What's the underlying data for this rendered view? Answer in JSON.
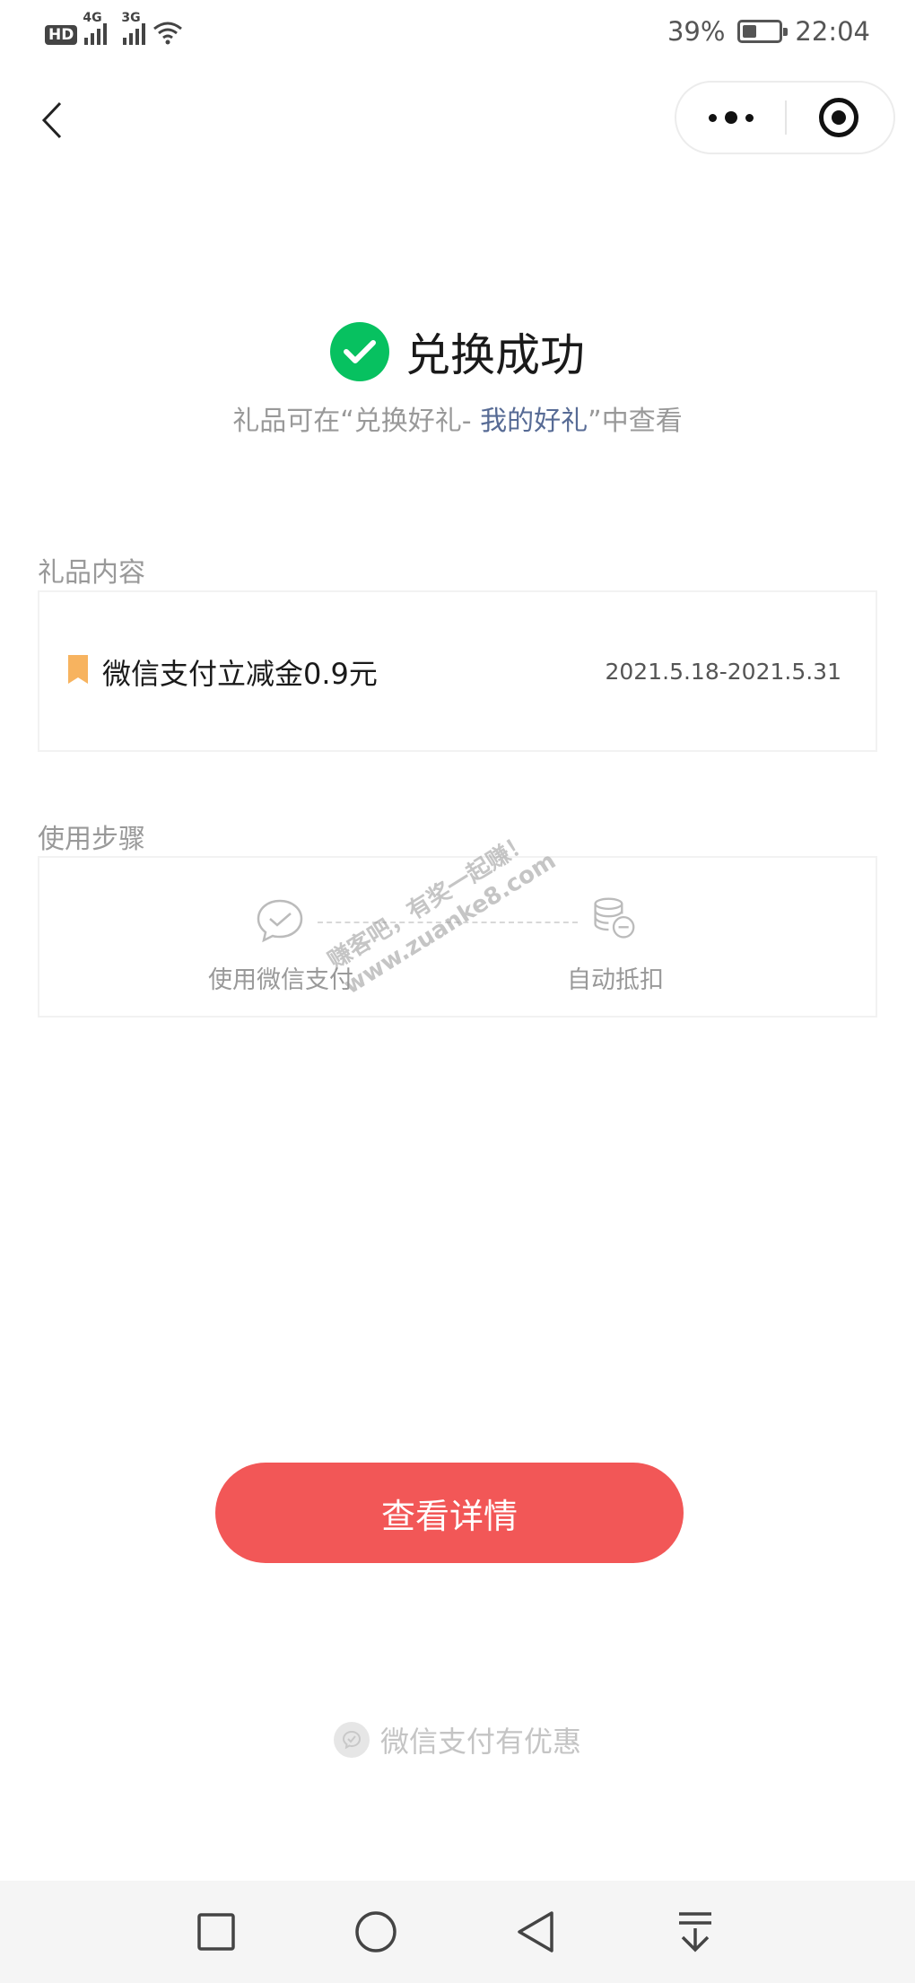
{
  "status_bar": {
    "hd": "HD",
    "net1": "4G",
    "net2": "3G",
    "battery_pct": "39%",
    "battery_level": 0.39,
    "time": "22:04"
  },
  "nav": {
    "back_icon": "chevron-left-icon",
    "more_icon": "more-dots-icon",
    "close_icon": "target-circle-icon"
  },
  "success": {
    "title": "兑换成功",
    "subtitle_prefix": "礼品可在“兑换好礼- ",
    "subtitle_link": "我的好礼",
    "subtitle_suffix": "”中查看",
    "icon": "check-circle-icon",
    "color": "#07c160"
  },
  "gift": {
    "section_label": "礼品内容",
    "name": "微信支付立减金0.9元",
    "date_range": "2021.5.18-2021.5.31",
    "icon": "bookmark-icon",
    "icon_color": "#f7b35f"
  },
  "steps": {
    "section_label": "使用步骤",
    "step1": "使用微信支付",
    "step2": "自动抵扣",
    "step1_icon": "wechat-pay-icon",
    "step2_icon": "coin-deduct-icon"
  },
  "watermark": {
    "line1": "赚客吧，有奖一起赚！",
    "line2": "www.zuanke8.com"
  },
  "primary_button": {
    "label": "查看详情",
    "color": "#f25757"
  },
  "footer": {
    "text": "微信支付有优惠",
    "icon": "wechat-pay-brand-icon"
  },
  "system_nav": {
    "recent": "square-icon",
    "home": "circle-icon",
    "back": "triangle-back-icon",
    "notifications": "pull-down-icon"
  }
}
